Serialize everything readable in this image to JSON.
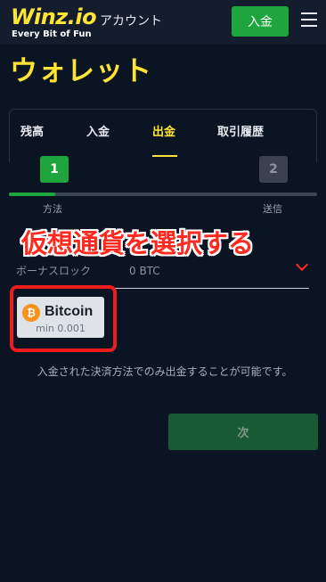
{
  "header": {
    "logo_main": "Winz.io",
    "logo_tagline": "Every Bit of Fun",
    "account_label": "アカウント",
    "deposit_button": "入金",
    "menu_icon": "hamburger-menu-icon"
  },
  "page": {
    "title": "ウォレット"
  },
  "tabs": [
    {
      "label": "残高",
      "active": false
    },
    {
      "label": "入金",
      "active": false
    },
    {
      "label": "出金",
      "active": true
    },
    {
      "label": "取引履歴",
      "active": false
    }
  ],
  "stepper": {
    "steps": [
      {
        "number": "1",
        "label": "方法",
        "active": true
      },
      {
        "number": "2",
        "label": "送信",
        "active": false
      }
    ],
    "progress_fraction": 0.15
  },
  "overlay": {
    "caption": "仮想通貨を選択する"
  },
  "bonus_lock": {
    "label": "ボーナスロック",
    "value": "0 BTC"
  },
  "methods": [
    {
      "name": "Bitcoin",
      "min": "min 0.001",
      "icon": "bitcoin-icon",
      "icon_glyph": "₿"
    }
  ],
  "note": "入金された決済方法でのみ出金することが可能です。",
  "next_button": "次",
  "colors": {
    "brand_yellow": "#ffe433",
    "accent_green": "#1ea53d",
    "highlight_red": "#ee1c1c",
    "bitcoin_orange": "#f7931a",
    "background": "#0b1423"
  }
}
